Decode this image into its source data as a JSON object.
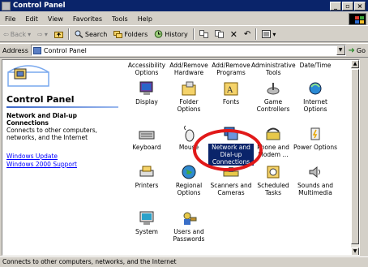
{
  "window": {
    "title": "Control Panel"
  },
  "menu": [
    "File",
    "Edit",
    "View",
    "Favorites",
    "Tools",
    "Help"
  ],
  "toolbar": {
    "back": "Back",
    "search": "Search",
    "folders": "Folders",
    "history": "History"
  },
  "address": {
    "label": "Address",
    "value": "Control Panel",
    "go": "Go"
  },
  "left": {
    "heading": "Control Panel",
    "selected_title": "Network and Dial-up Connections",
    "selected_desc": "Connects to other computers, networks, and the Internet",
    "links": [
      "Windows Update",
      "Windows 2000 Support"
    ]
  },
  "items": [
    {
      "label": "Accessibility Options",
      "icon": "accessibility-icon"
    },
    {
      "label": "Add/Remove Hardware",
      "icon": "hardware-icon"
    },
    {
      "label": "Add/Remove Programs",
      "icon": "programs-icon"
    },
    {
      "label": "Administrative Tools",
      "icon": "admin-tools-icon"
    },
    {
      "label": "Date/Time",
      "icon": "clock-icon"
    },
    {
      "label": "Display",
      "icon": "display-icon"
    },
    {
      "label": "Folder Options",
      "icon": "folder-options-icon"
    },
    {
      "label": "Fonts",
      "icon": "fonts-icon"
    },
    {
      "label": "Game Controllers",
      "icon": "game-controller-icon"
    },
    {
      "label": "Internet Options",
      "icon": "internet-options-icon"
    },
    {
      "label": "Keyboard",
      "icon": "keyboard-icon"
    },
    {
      "label": "Mouse",
      "icon": "mouse-icon"
    },
    {
      "label": "Network and Dial-up Connections",
      "icon": "network-icon"
    },
    {
      "label": "Phone and Modem ...",
      "icon": "phone-icon"
    },
    {
      "label": "Power Options",
      "icon": "power-icon"
    },
    {
      "label": "Printers",
      "icon": "printer-icon"
    },
    {
      "label": "Regional Options",
      "icon": "globe-icon"
    },
    {
      "label": "Scanners and Cameras",
      "icon": "scanner-icon"
    },
    {
      "label": "Scheduled Tasks",
      "icon": "scheduled-tasks-icon"
    },
    {
      "label": "Sounds and Multimedia",
      "icon": "sound-icon"
    },
    {
      "label": "System",
      "icon": "system-icon"
    },
    {
      "label": "Users and Passwords",
      "icon": "users-icon"
    }
  ],
  "status": "Connects to other computers, networks, and the Internet"
}
